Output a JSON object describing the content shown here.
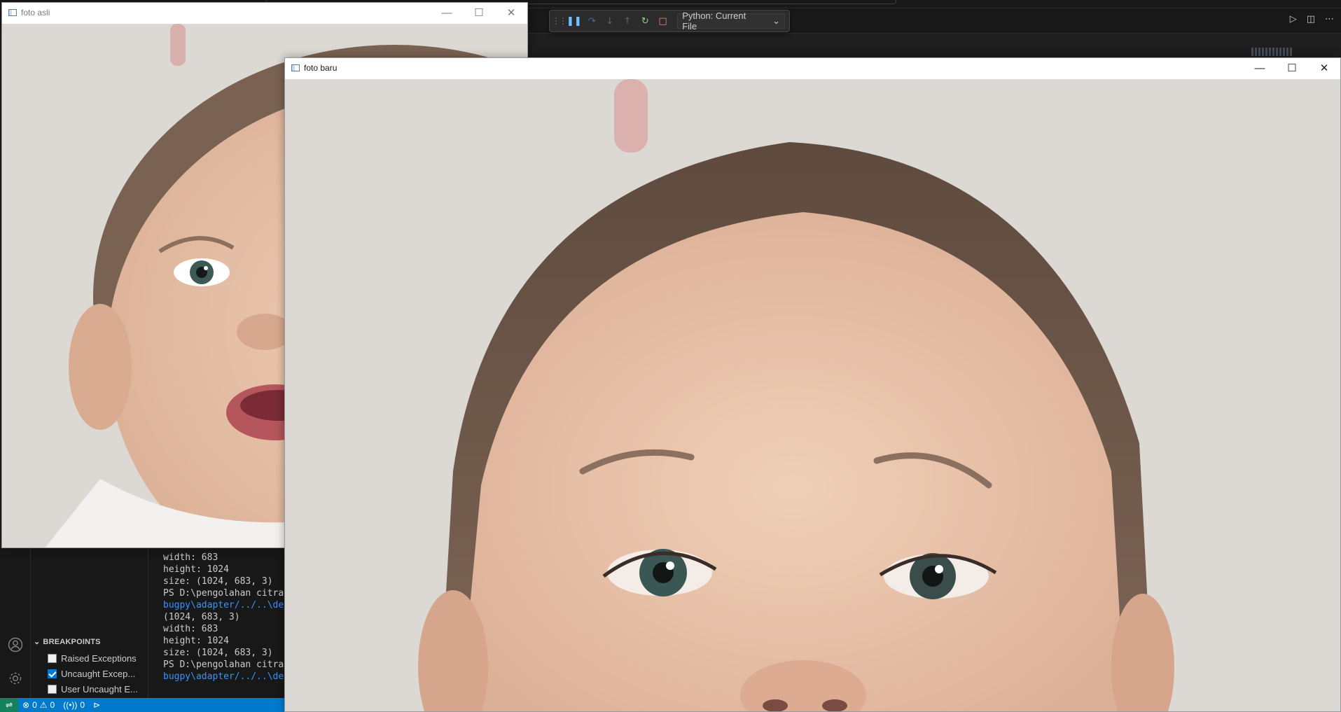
{
  "debug_toolbar": {
    "config_label": "Python: Current File",
    "buttons": [
      "grip-icon",
      "pause-icon",
      "step-over-icon",
      "step-into-icon",
      "step-out-icon",
      "restart-icon",
      "stop-icon"
    ]
  },
  "breakpoints": {
    "header": "BREAKPOINTS",
    "items": [
      {
        "label": "Raised Exceptions",
        "checked": false
      },
      {
        "label": "Uncaught Excep...",
        "checked": true
      },
      {
        "label": "User Uncaught E...",
        "checked": false
      }
    ]
  },
  "terminal": {
    "lines": [
      {
        "text": "width: 683",
        "link": false
      },
      {
        "text": "height: 1024",
        "link": false
      },
      {
        "text": "size: (1024, 683, 3)",
        "link": false
      },
      {
        "text": "PS D:\\pengolahan citra\\re",
        "link": false
      },
      {
        "text": "bugpy\\adapter/../..\\debug",
        "link": true
      },
      {
        "text": "(1024, 683, 3)",
        "link": false
      },
      {
        "text": "width: 683",
        "link": false
      },
      {
        "text": "height: 1024",
        "link": false
      },
      {
        "text": "size: (1024, 683, 3)",
        "link": false
      },
      {
        "text": "PS D:\\pengolahan citra\\re",
        "link": false
      },
      {
        "text": "bugpy\\adapter/../..\\debug",
        "link": true
      }
    ]
  },
  "statusbar": {
    "errors": "0",
    "warnings": "0",
    "ports": "0"
  },
  "windows": {
    "original": {
      "title": "foto asli"
    },
    "new": {
      "title": "foto baru"
    }
  },
  "colors": {
    "accent": "#007acc",
    "photo_background": "#dcd8d4",
    "skin": "#e2bfa6",
    "hair": "#6e5a4c"
  }
}
